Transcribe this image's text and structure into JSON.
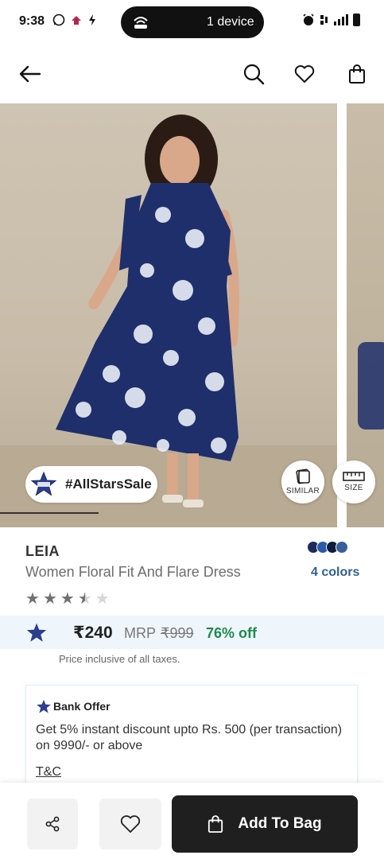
{
  "status_bar": {
    "time": "9:38",
    "device_pill": "1 device"
  },
  "header": {
    "back_icon": "arrow-left-icon",
    "search_icon": "search-icon",
    "wishlist_icon": "heart-icon",
    "bag_icon": "bag-icon"
  },
  "image": {
    "sale_chip_label": "#AllStarsSale",
    "similar_label": "SIMILAR",
    "size_label": "SIZE",
    "carousel_position": 1
  },
  "product": {
    "brand": "LEIA",
    "title": "Women Floral Fit And Flare Dress",
    "colors_label": "4 colors",
    "swatch_colors": [
      "#1d2c5c",
      "#2a5aa8",
      "#0f1c3e",
      "#385e9c"
    ],
    "rating": 3.5,
    "rating_max": 5,
    "price": "₹240",
    "mrp_label": "MRP",
    "mrp_value": "₹999",
    "discount": "76% off",
    "tax_note": "Price inclusive of all taxes."
  },
  "offer": {
    "title": "Bank Offer",
    "body": "Get 5% instant discount upto Rs. 500 (per transaction) on 9990/- or above",
    "tc_label": "T&C"
  },
  "bottom_bar": {
    "share_icon": "share-icon",
    "wishlist_icon": "heart-icon",
    "add_to_bag_label": "Add To Bag"
  },
  "colors": {
    "accent_green": "#1e8a4c",
    "link_blue": "#2f5f8f",
    "price_band": "#eef6fb",
    "cta": "#1f1f1f"
  }
}
